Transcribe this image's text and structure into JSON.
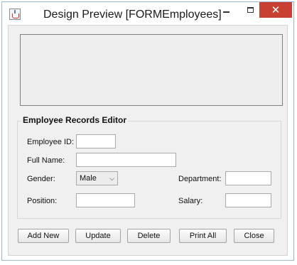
{
  "window": {
    "title": "Design Preview [FORMEmployees]",
    "close_glyph": "✕"
  },
  "icons": {
    "app": "java-cup-icon",
    "minimize": "minimize-icon",
    "maximize": "maximize-icon",
    "close": "close-icon",
    "dropdown": "chevron-down-icon"
  },
  "form": {
    "group_title": "Employee Records Editor",
    "employee_id": {
      "label": "Employee ID:",
      "value": ""
    },
    "full_name": {
      "label": "Full Name:",
      "value": ""
    },
    "gender": {
      "label": "Gender:",
      "selected": "Male"
    },
    "department": {
      "label": "Department:",
      "value": ""
    },
    "position": {
      "label": "Position:",
      "value": ""
    },
    "salary": {
      "label": "Salary:",
      "value": ""
    }
  },
  "buttons": {
    "add_new": "Add New",
    "update": "Update",
    "delete": "Delete",
    "print_all": "Print All",
    "close": "Close"
  },
  "colors": {
    "close_button": "#c84031",
    "panel_background": "#f0f0f0"
  }
}
